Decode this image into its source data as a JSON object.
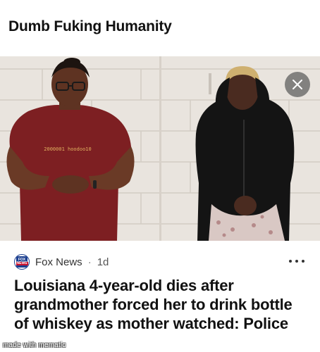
{
  "meme": {
    "caption": "Dumb Fuking Humanity",
    "watermark": "made with mematic"
  },
  "photo": {
    "shirt_print": "2000001 hoodoo10"
  },
  "article": {
    "source": "Fox News",
    "separator": "·",
    "time": "1d",
    "logo_top": "FOX",
    "logo_bottom": "NEWS",
    "headline": "Louisiana 4-year-old dies after grandmother forced her to drink bottle of whiskey as mother watched: Police"
  },
  "icons": {
    "close": "close-icon",
    "more": "more-options-icon",
    "source_logo": "fox-news-logo-icon"
  },
  "colors": {
    "wall": "#e8e3dd",
    "close_bg": "#5a5a5a",
    "fox_blue": "#1b3f8f",
    "fox_red": "#c8102e"
  }
}
